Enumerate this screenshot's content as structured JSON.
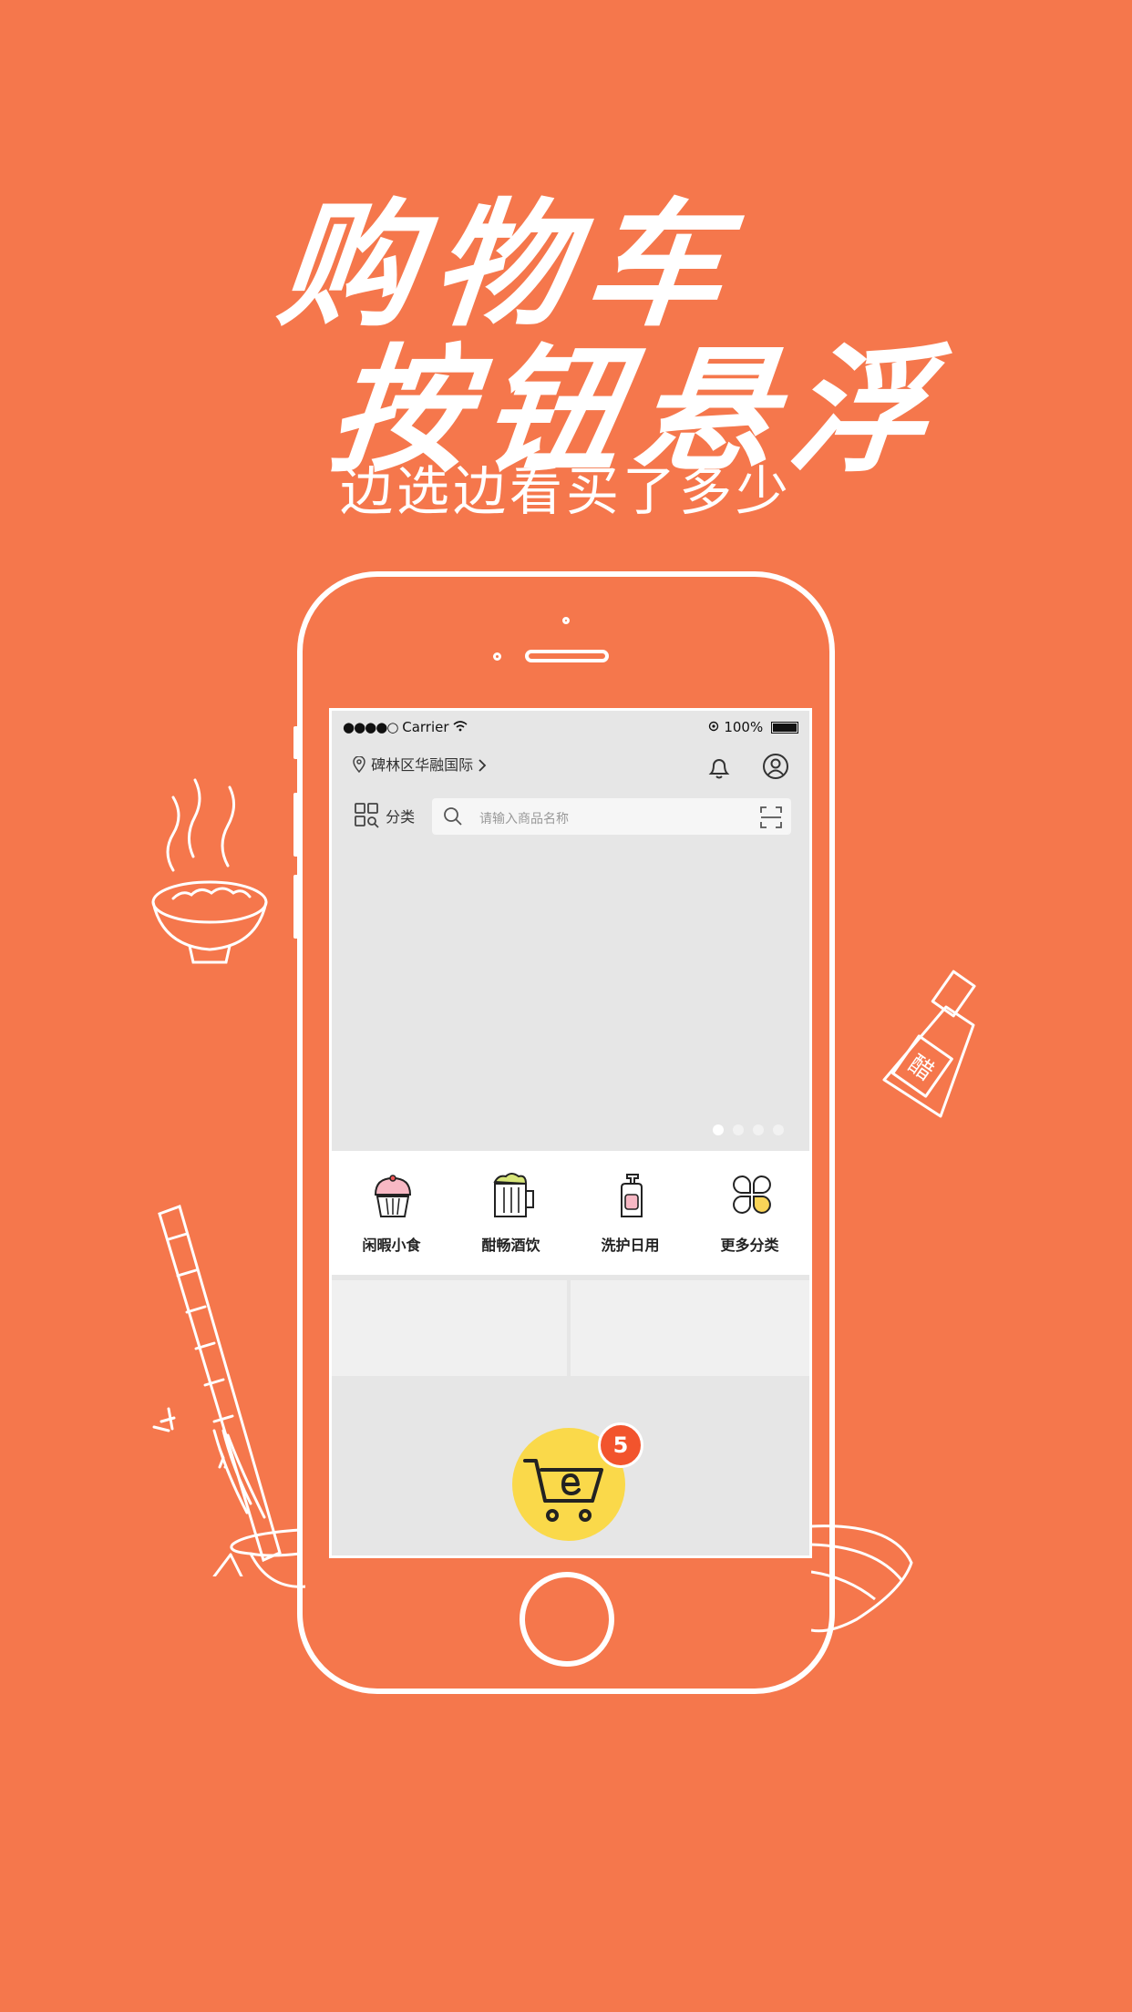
{
  "promo": {
    "headline_line1": "购物车",
    "headline_line2": "按钮悬浮",
    "subheadline": "边选边看买了多少"
  },
  "status_bar": {
    "signal": "●●●●○",
    "carrier": "Carrier",
    "battery": "100%"
  },
  "header": {
    "location": "碑林区华融国际",
    "category_label": "分类"
  },
  "search": {
    "placeholder": "请输入商品名称"
  },
  "categories": [
    {
      "label": "闲暇小食"
    },
    {
      "label": "酣畅酒饮"
    },
    {
      "label": "洗护日用"
    },
    {
      "label": "更多分类"
    }
  ],
  "cart": {
    "count": "5"
  },
  "colors": {
    "background": "#F5774C",
    "cart_button": "#FAD94A",
    "badge": "#F2542D"
  }
}
